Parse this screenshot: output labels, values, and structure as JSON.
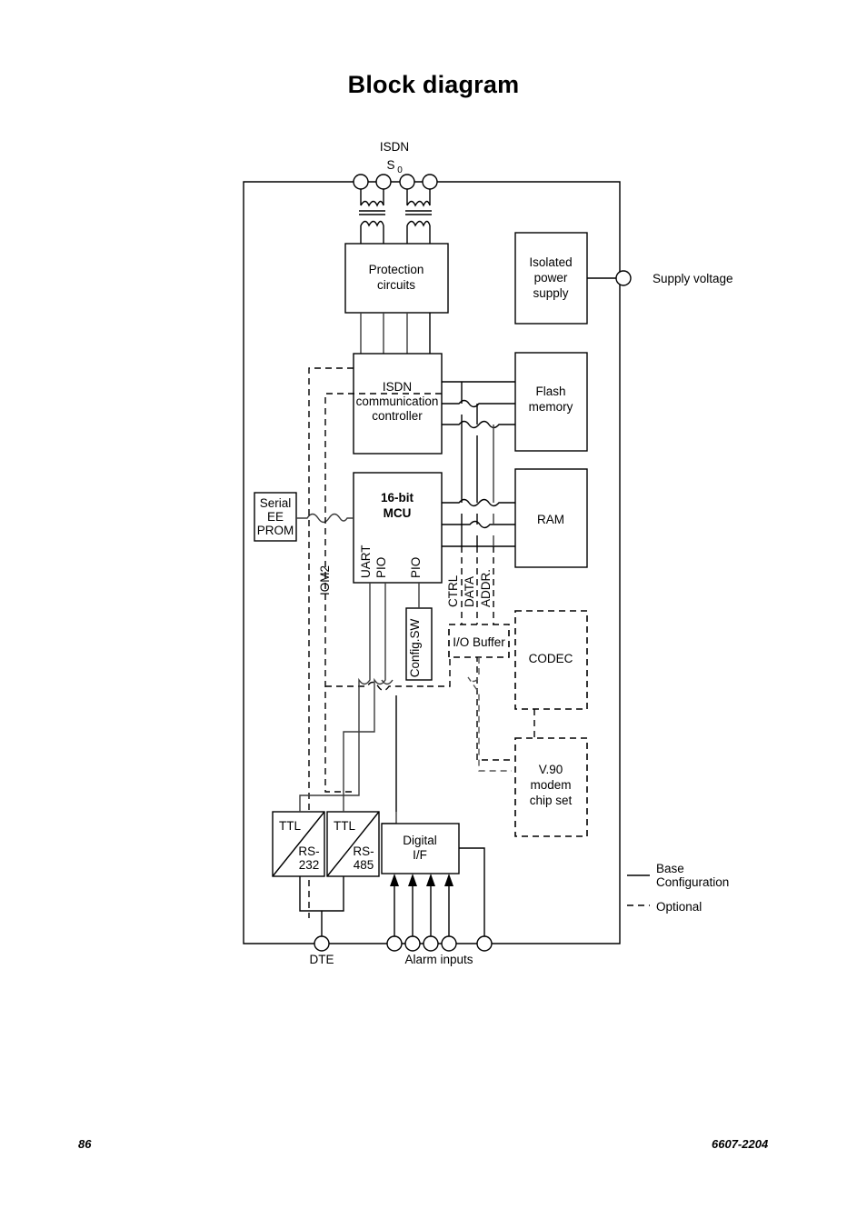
{
  "page": {
    "title": "Block diagram",
    "footer_page": "86",
    "footer_doc": "6607-2204"
  },
  "diagram": {
    "terminals": {
      "isdn_label_line1": "ISDN",
      "isdn_label_sub": "S",
      "isdn_label_subscript": "0",
      "supply_voltage": "Supply voltage",
      "dte": "DTE",
      "alarm_inputs": "Alarm inputs"
    },
    "blocks": {
      "protection": "Protection\ncircuits",
      "protection_l1": "Protection",
      "protection_l2": "circuits",
      "isolated_power_l1": "Isolated",
      "isolated_power_l2": "power",
      "isolated_power_l3": "supply",
      "isdn_controller_l1": "ISDN",
      "isdn_controller_l2": "communication",
      "isdn_controller_l3": "controller",
      "flash_l1": "Flash",
      "flash_l2": "memory",
      "mcu_l1": "16-bit",
      "mcu_l2": "MCU",
      "ram": "RAM",
      "serial_eeprom_l1": "Serial",
      "serial_eeprom_l2": "EE",
      "serial_eeprom_l3": "PROM",
      "config_sw": "Config.SW",
      "io_buffer": "I/O Buffer",
      "codec": "CODEC",
      "v90_l1": "V.90",
      "v90_l2": "modem",
      "v90_l3": "chip set",
      "digital_if_l1": "Digital",
      "digital_if_l2": "I/F",
      "ttl_a": "TTL",
      "rs232_l1": "RS-",
      "rs232_l2": "232",
      "ttl_b": "TTL",
      "rs485_l1": "RS-",
      "rs485_l2": "485"
    },
    "bus_labels": {
      "ctrl": "CTRL",
      "data": "DATA",
      "addr": "ADDR.",
      "iom2": "IOM2",
      "uart": "UART",
      "pio_1": "PIO",
      "pio_2": "PIO"
    },
    "legend": {
      "base_l1": "Base",
      "base_l2": "Configuration",
      "optional": "Optional"
    }
  }
}
